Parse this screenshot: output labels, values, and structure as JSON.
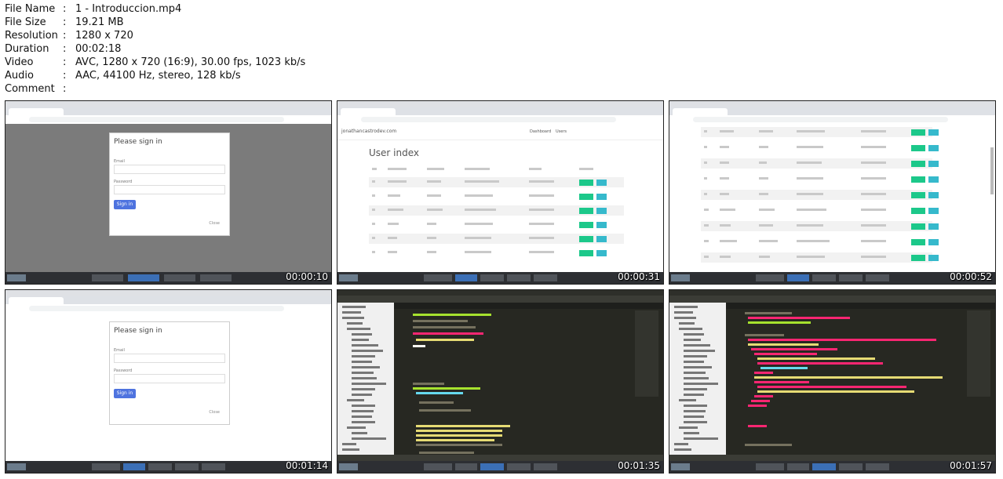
{
  "info": {
    "rows": [
      {
        "key": "File Name",
        "sep": ":",
        "value": "1 - Introduccion.mp4"
      },
      {
        "key": "File Size",
        "sep": ":",
        "value": "19.21 MB"
      },
      {
        "key": "Resolution",
        "sep": ":",
        "value": "1280 x 720"
      },
      {
        "key": "Duration",
        "sep": ":",
        "value": "00:02:18"
      },
      {
        "key": "Video",
        "sep": ":",
        "value": "AVC, 1280 x 720 (16:9), 30.00 fps, 1023 kb/s"
      },
      {
        "key": "Audio",
        "sep": ":",
        "value": "AAC, 44100 Hz, stereo, 128 kb/s"
      },
      {
        "key": "Comment",
        "sep": ":",
        "value": ""
      }
    ]
  },
  "thumbnails": [
    {
      "timestamp": "00:00:10",
      "card": {
        "title": "Please sign in",
        "email_label": "Email",
        "password_label": "Password",
        "button": "Sign in",
        "close": "Close"
      }
    },
    {
      "timestamp": "00:00:31",
      "page": {
        "title": "User index",
        "brand": "jonathancastrodev.com",
        "nav1": "Dashboard",
        "nav2": "Users"
      }
    },
    {
      "timestamp": "00:00:52"
    },
    {
      "timestamp": "00:01:14",
      "card": {
        "title": "Please sign in",
        "email_label": "Email",
        "password_label": "Password",
        "button": "Sign in",
        "close": "Close"
      }
    },
    {
      "timestamp": "00:01:35"
    },
    {
      "timestamp": "00:01:57"
    }
  ],
  "colors": {
    "accent_button": "#4e73df",
    "show_button": "#1cc88a",
    "edit_button": "#36b9cc",
    "editor_bg": "#272822"
  }
}
